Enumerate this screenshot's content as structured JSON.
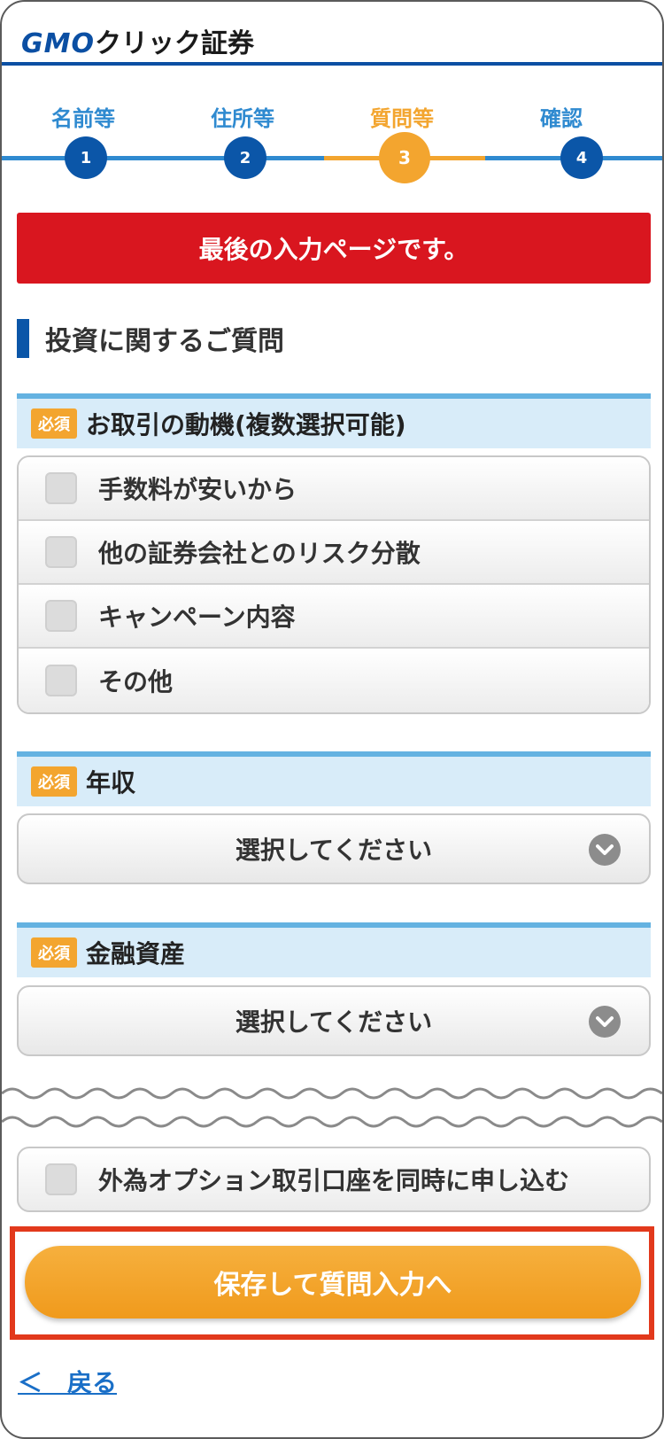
{
  "header": {
    "logo_gmo": "GMO",
    "logo_rest": "クリック証券"
  },
  "steps": [
    {
      "label": "名前等",
      "number": "1"
    },
    {
      "label": "住所等",
      "number": "2"
    },
    {
      "label": "質問等",
      "number": "3"
    },
    {
      "label": "確認",
      "number": "4"
    }
  ],
  "alert": "最後の入力ページです。",
  "section_title": "投資に関するご質問",
  "required_badge": "必須",
  "questions": {
    "motive": {
      "title": "お取引の動機(複数選択可能)",
      "options": [
        "手数料が安いから",
        "他の証券会社とのリスク分散",
        "キャンペーン内容",
        "その他"
      ]
    },
    "income": {
      "title": "年収",
      "select_value": "選択してください"
    },
    "assets": {
      "title": "金融資産",
      "select_value": "選択してください"
    }
  },
  "fx_option": "外為オプション取引口座を同時に申し込む",
  "save_button": "保存して質問入力へ",
  "back_link": "＜　戻る",
  "colors": {
    "brand_blue": "#0b56a8",
    "active_orange": "#f3a52f",
    "alert_red": "#d9161f",
    "highlight_red": "#e2391c"
  }
}
